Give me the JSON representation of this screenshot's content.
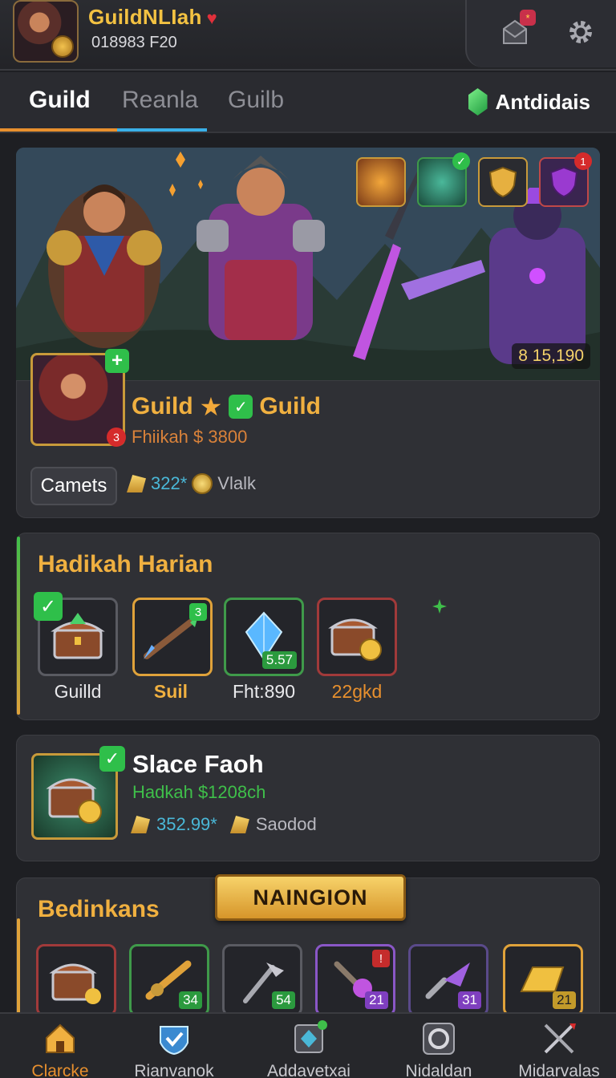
{
  "header": {
    "username": "GuildNLIah",
    "subtitle": "018983 F20",
    "heart_icon": "heart-icon",
    "mail_badge": "*",
    "settings_icon": "gear-icon"
  },
  "tabs": [
    {
      "label": "Guild",
      "active": true
    },
    {
      "label": "Reanla",
      "active": false
    },
    {
      "label": "Guilb",
      "active": false
    }
  ],
  "currency": {
    "label": "Antdidais",
    "icon": "green-gem-icon"
  },
  "hero": {
    "power": "8 15,190",
    "badge_red": "1"
  },
  "guild": {
    "name_left": "Guild",
    "name_right": "Guild",
    "subtitle": "Fhiikah $ 3800",
    "avatar_plus": "+",
    "avatar_badge": "3",
    "button_label": "Camets",
    "stat_value": "322*",
    "stat_label": "Vlalk"
  },
  "daily": {
    "title": "Hadikah Harian",
    "items": [
      {
        "label": "Guilld",
        "label_color": "#e9e9ec",
        "corner": "✓",
        "count": ""
      },
      {
        "label": "Suil",
        "label_color": "#f0b040",
        "corner": "3",
        "count": ""
      },
      {
        "label": "Fht:890",
        "label_color": "#e9e9ec",
        "corner": "",
        "count": "5.57"
      },
      {
        "label": "22gkd",
        "label_color": "#e8902e",
        "corner": "",
        "count": ""
      }
    ]
  },
  "special": {
    "title": "Slace Faoh",
    "subtitle": "Hadkah $1208ch",
    "stat_value": "352.99*",
    "stat_label": "Saodod"
  },
  "bottom_section": {
    "title": "Bedinkans",
    "banner_label": "NAINGION",
    "items": [
      {
        "count": ""
      },
      {
        "count": "34"
      },
      {
        "count": "54"
      },
      {
        "count": "21",
        "corner": "!"
      },
      {
        "count": "31"
      },
      {
        "count": "21"
      }
    ]
  },
  "nav": [
    {
      "label": "Clarcke",
      "icon": "home-icon",
      "active": true
    },
    {
      "label": "Rianvanok",
      "icon": "shield-check-icon",
      "active": false
    },
    {
      "label": "Addavetxai",
      "icon": "diamond-frame-icon",
      "active": false
    },
    {
      "label": "Nidaldan",
      "icon": "ring-icon",
      "active": false
    },
    {
      "label": "Midarvalas",
      "icon": "crossed-swords-icon",
      "active": false
    }
  ],
  "colors": {
    "accent_gold": "#f0b040",
    "accent_orange": "#e8902e",
    "accent_green": "#2fbf4a",
    "tab_underline_orange": "#e8902e",
    "tab_underline_blue": "#3ab0e8",
    "background": "#1e1f23"
  }
}
